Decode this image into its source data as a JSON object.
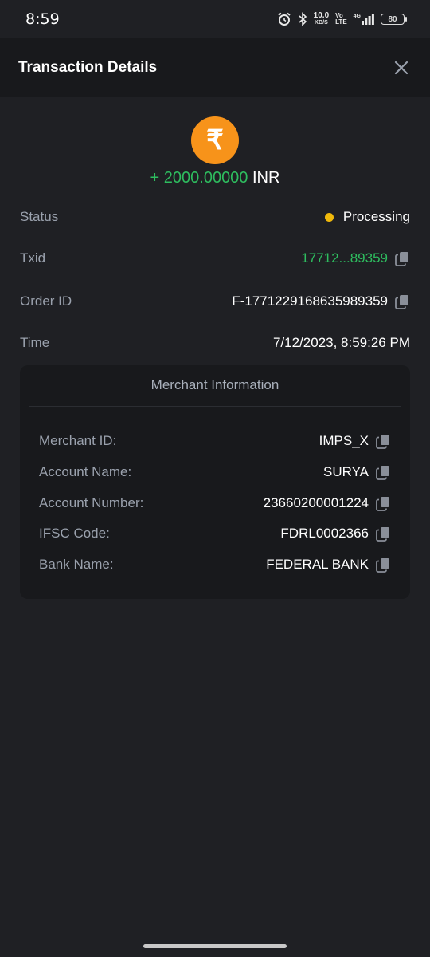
{
  "status_bar": {
    "time": "8:59",
    "net_speed": "10.0",
    "net_unit": "KB/S",
    "volte_top": "Vo",
    "volte_bottom": "LTE",
    "signal_label": "4G",
    "battery": "80"
  },
  "header": {
    "title": "Transaction Details",
    "close_icon": "close-icon"
  },
  "amount": {
    "currency_icon": "rupee-icon",
    "icon_glyph": "₹",
    "sign_value": "+ 2000.00000",
    "currency": "INR",
    "colors": {
      "positive": "#2ebd5f",
      "coin": "#f7931a"
    }
  },
  "details": {
    "status": {
      "label": "Status",
      "value": "Processing",
      "dot_color": "#f0b90b"
    },
    "txid": {
      "label": "Txid",
      "value": "17712...89359"
    },
    "order_id": {
      "label": "Order ID",
      "value": "F-1771229168635989359"
    },
    "time": {
      "label": "Time",
      "value": "7/12/2023, 8:59:26 PM"
    }
  },
  "merchant": {
    "title": "Merchant Information",
    "rows": [
      {
        "label": "Merchant ID:",
        "value": "IMPS_X"
      },
      {
        "label": "Account Name:",
        "value": "SURYA"
      },
      {
        "label": "Account Number:",
        "value": "23660200001224"
      },
      {
        "label": "IFSC Code:",
        "value": "FDRL0002366"
      },
      {
        "label": "Bank Name:",
        "value": "FEDERAL BANK"
      }
    ]
  }
}
